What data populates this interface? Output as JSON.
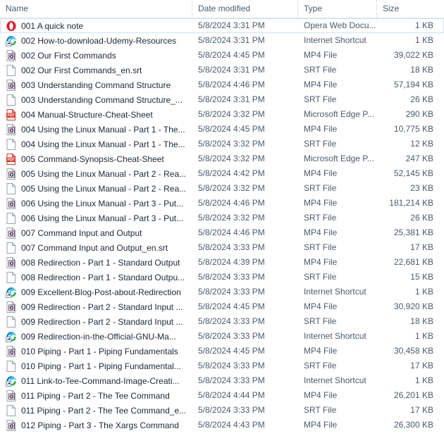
{
  "columns": {
    "name": "Name",
    "date_modified": "Date modified",
    "type": "Type",
    "size": "Size"
  },
  "colors": {
    "header_text": "#4a5b70",
    "row_text": "#1d2733",
    "secondary_text": "#4e5a69",
    "selection_border": "#cce3f2",
    "pdf_red": "#d93025",
    "opera_red": "#e2172b",
    "edge_blue": "#0f7ebf",
    "edge_green": "#35b15a",
    "mp4_purple": "#6a2f7a"
  },
  "files": [
    {
      "icon": "opera-icon",
      "name": "001 A quick note",
      "date": "5/8/2024 3:31 PM",
      "type": "Opera Web Docu...",
      "size": "1 KB",
      "selected": true
    },
    {
      "icon": "edge-shortcut-icon",
      "name": "002 How-to-download-Udemy-Resources",
      "date": "5/8/2024 3:31 PM",
      "type": "Internet Shortcut",
      "size": "1 KB",
      "selected": false
    },
    {
      "icon": "mp4-icon",
      "name": "002 Our First Commands",
      "date": "5/8/2024 4:45 PM",
      "type": "MP4 File",
      "size": "39,022 KB",
      "selected": false
    },
    {
      "icon": "srt-icon",
      "name": "002 Our First Commands_en.srt",
      "date": "5/8/2024 3:31 PM",
      "type": "SRT File",
      "size": "18 KB",
      "selected": false
    },
    {
      "icon": "mp4-icon",
      "name": "003 Understanding Command Structure",
      "date": "5/8/2024 4:46 PM",
      "type": "MP4 File",
      "size": "57,194 KB",
      "selected": false
    },
    {
      "icon": "srt-icon",
      "name": "003 Understanding Command Structure_...",
      "date": "5/8/2024 3:31 PM",
      "type": "SRT File",
      "size": "26 KB",
      "selected": false
    },
    {
      "icon": "pdf-icon",
      "name": "004 Manual-Structure-Cheat-Sheet",
      "date": "5/8/2024 3:32 PM",
      "type": "Microsoft Edge P...",
      "size": "290 KB",
      "selected": false
    },
    {
      "icon": "mp4-icon",
      "name": "004 Using the Linux Manual - Part 1 - The...",
      "date": "5/8/2024 4:45 PM",
      "type": "MP4 File",
      "size": "10,775 KB",
      "selected": false
    },
    {
      "icon": "srt-icon",
      "name": "004 Using the Linux Manual - Part 1 - The...",
      "date": "5/8/2024 3:32 PM",
      "type": "SRT File",
      "size": "12 KB",
      "selected": false
    },
    {
      "icon": "pdf-icon",
      "name": "005 Command-Synopsis-Cheat-Sheet",
      "date": "5/8/2024 3:32 PM",
      "type": "Microsoft Edge P...",
      "size": "247 KB",
      "selected": false
    },
    {
      "icon": "mp4-icon",
      "name": "005 Using the Linux Manual - Part 2 - Rea...",
      "date": "5/8/2024 4:42 PM",
      "type": "MP4 File",
      "size": "52,145 KB",
      "selected": false
    },
    {
      "icon": "srt-icon",
      "name": "005 Using the Linux Manual - Part 2 - Rea...",
      "date": "5/8/2024 3:32 PM",
      "type": "SRT File",
      "size": "23 KB",
      "selected": false
    },
    {
      "icon": "mp4-icon",
      "name": "006 Using the Linux Manual - Part 3 - Put...",
      "date": "5/8/2024 4:46 PM",
      "type": "MP4 File",
      "size": "181,214 KB",
      "selected": false
    },
    {
      "icon": "srt-icon",
      "name": "006 Using the Linux Manual - Part 3 - Put...",
      "date": "5/8/2024 3:32 PM",
      "type": "SRT File",
      "size": "26 KB",
      "selected": false
    },
    {
      "icon": "mp4-icon",
      "name": "007 Command Input and Output",
      "date": "5/8/2024 4:46 PM",
      "type": "MP4 File",
      "size": "25,381 KB",
      "selected": false
    },
    {
      "icon": "srt-icon",
      "name": "007 Command Input and Output_en.srt",
      "date": "5/8/2024 3:33 PM",
      "type": "SRT File",
      "size": "17 KB",
      "selected": false
    },
    {
      "icon": "mp4-icon",
      "name": "008 Redirection - Part 1 - Standard Output",
      "date": "5/8/2024 4:39 PM",
      "type": "MP4 File",
      "size": "22,681 KB",
      "selected": false
    },
    {
      "icon": "srt-icon",
      "name": "008 Redirection - Part 1 - Standard Outpu...",
      "date": "5/8/2024 3:33 PM",
      "type": "SRT File",
      "size": "15 KB",
      "selected": false
    },
    {
      "icon": "edge-shortcut-icon",
      "name": "009 Excellent-Blog-Post-about-Redirection",
      "date": "5/8/2024 3:33 PM",
      "type": "Internet Shortcut",
      "size": "1 KB",
      "selected": false
    },
    {
      "icon": "mp4-icon",
      "name": "009 Redirection - Part 2 - Standard Input ...",
      "date": "5/8/2024 4:45 PM",
      "type": "MP4 File",
      "size": "30,920 KB",
      "selected": false
    },
    {
      "icon": "srt-icon",
      "name": "009 Redirection - Part 2 - Standard Input ...",
      "date": "5/8/2024 3:33 PM",
      "type": "SRT File",
      "size": "18 KB",
      "selected": false
    },
    {
      "icon": "edge-shortcut-icon",
      "name": "009 Redirection-in-the-Official-GNU-Ma...",
      "date": "5/8/2024 3:33 PM",
      "type": "Internet Shortcut",
      "size": "1 KB",
      "selected": false
    },
    {
      "icon": "mp4-icon",
      "name": "010 Piping - Part 1 - Piping Fundamentals",
      "date": "5/8/2024 4:45 PM",
      "type": "MP4 File",
      "size": "30,458 KB",
      "selected": false
    },
    {
      "icon": "srt-icon",
      "name": "010 Piping - Part 1 - Piping Fundamental...",
      "date": "5/8/2024 3:33 PM",
      "type": "SRT File",
      "size": "17 KB",
      "selected": false
    },
    {
      "icon": "edge-shortcut-icon",
      "name": "011 Link-to-Tee-Command-Image-Creati...",
      "date": "5/8/2024 3:33 PM",
      "type": "Internet Shortcut",
      "size": "1 KB",
      "selected": false
    },
    {
      "icon": "mp4-icon",
      "name": "011 Piping - Part 2 - The Tee Command",
      "date": "5/8/2024 4:44 PM",
      "type": "MP4 File",
      "size": "26,201 KB",
      "selected": false
    },
    {
      "icon": "srt-icon",
      "name": "011 Piping - Part 2 - The Tee Command_e...",
      "date": "5/8/2024 3:33 PM",
      "type": "SRT File",
      "size": "17 KB",
      "selected": false
    },
    {
      "icon": "mp4-icon",
      "name": "012 Piping - Part 3 - The Xargs Command",
      "date": "5/8/2024 4:43 PM",
      "type": "MP4 File",
      "size": "26,300 KB",
      "selected": false
    }
  ]
}
